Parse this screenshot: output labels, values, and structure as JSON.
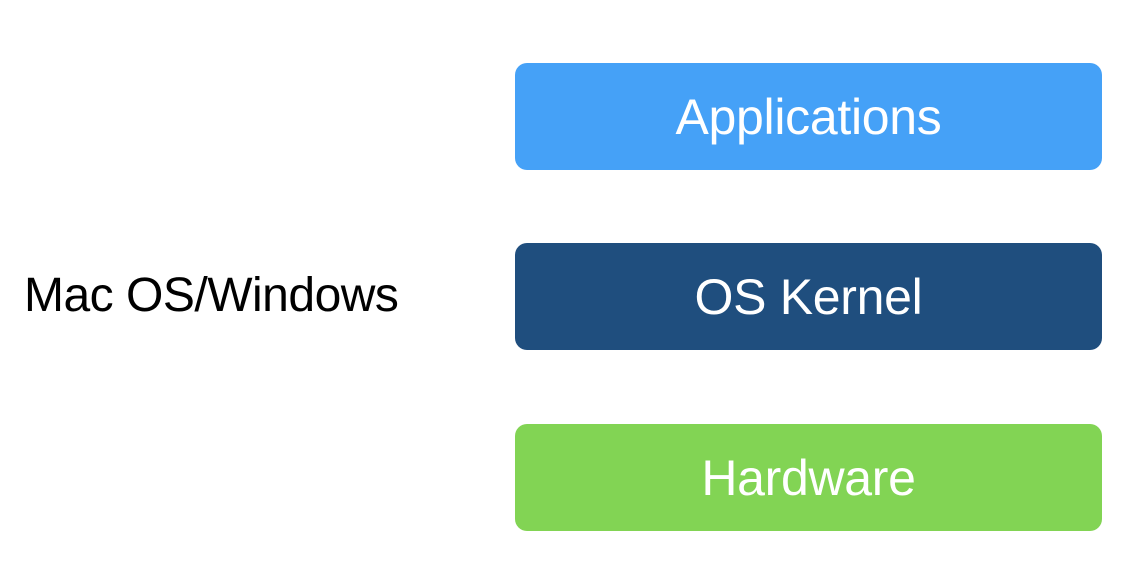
{
  "diagram": {
    "side_label": "Mac OS/Windows",
    "layers": [
      {
        "label": "Applications",
        "color": "#45A1F7"
      },
      {
        "label": "OS Kernel",
        "color": "#1F4E7E"
      },
      {
        "label": "Hardware",
        "color": "#82D454"
      }
    ]
  }
}
